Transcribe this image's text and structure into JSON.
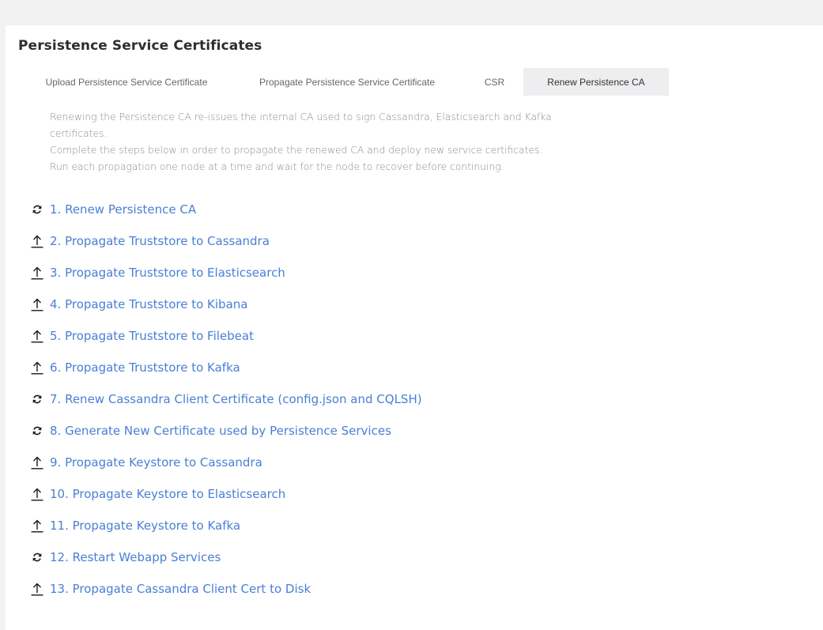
{
  "page": {
    "title": "Persistence Service Certificates"
  },
  "tabs": [
    {
      "label": "Upload Persistence Service Certificate",
      "active": false
    },
    {
      "label": "Propagate Persistence Service Certificate",
      "active": false
    },
    {
      "label": "CSR",
      "active": false
    },
    {
      "label": "Renew Persistence CA",
      "active": true
    }
  ],
  "description": {
    "line1": "Renewing the Persistence CA re-issues the internal CA used to sign Cassandra, Elasticsearch and Kafka certificates.",
    "line2": "Complete the steps below in order to propagate the renewed CA and deploy new service certificates.",
    "line3": "Run each propagation one node at a time and wait for the node to recover before continuing."
  },
  "colors": {
    "link": "#4a7fd4",
    "icon": "#1a1a1a",
    "active_tab_bg": "#eeeef0"
  },
  "steps": [
    {
      "label": "1. Renew Persistence CA",
      "icon": "refresh-icon"
    },
    {
      "label": "2. Propagate Truststore to Cassandra",
      "icon": "upload-icon"
    },
    {
      "label": "3. Propagate Truststore to Elasticsearch",
      "icon": "upload-icon"
    },
    {
      "label": "4. Propagate Truststore to Kibana",
      "icon": "upload-icon"
    },
    {
      "label": "5. Propagate Truststore to Filebeat",
      "icon": "upload-icon"
    },
    {
      "label": "6. Propagate Truststore to Kafka",
      "icon": "upload-icon"
    },
    {
      "label": "7. Renew Cassandra Client Certificate (config.json and CQLSH)",
      "icon": "refresh-icon"
    },
    {
      "label": "8. Generate New Certificate used by Persistence Services",
      "icon": "refresh-icon"
    },
    {
      "label": "9. Propagate Keystore to Cassandra",
      "icon": "upload-icon"
    },
    {
      "label": "10. Propagate Keystore to Elasticsearch",
      "icon": "upload-icon"
    },
    {
      "label": "11. Propagate Keystore to Kafka",
      "icon": "upload-icon"
    },
    {
      "label": "12. Restart Webapp Services",
      "icon": "refresh-icon"
    },
    {
      "label": "13. Propagate Cassandra Client Cert to Disk",
      "icon": "upload-icon"
    }
  ]
}
